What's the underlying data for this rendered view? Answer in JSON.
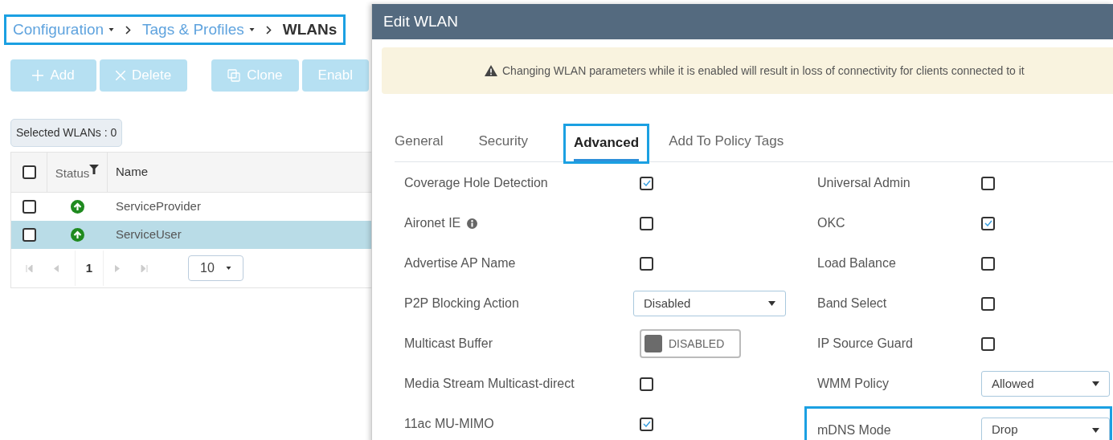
{
  "breadcrumb": {
    "highlighted": true,
    "items": [
      {
        "label": "Configuration",
        "dropdown": true,
        "current": false
      },
      {
        "label": "Tags & Profiles",
        "dropdown": true,
        "current": false
      },
      {
        "label": "WLANs",
        "dropdown": false,
        "current": true
      }
    ]
  },
  "toolbar": [
    {
      "label": "Add"
    },
    {
      "label": "Delete"
    },
    {
      "label": "Clone"
    },
    {
      "label": "Enabl"
    }
  ],
  "selected_count": "Selected WLANs : 0",
  "table": {
    "header_checked": false,
    "columns": [
      "Status",
      "Name"
    ],
    "rows": [
      {
        "checked": false,
        "name": "ServiceProvider",
        "selected": false
      },
      {
        "checked": false,
        "name": "ServiceUser",
        "selected": true
      }
    ]
  },
  "pagination": {
    "page": "1",
    "page_size": "10"
  },
  "modal": {
    "title": "Edit WLAN",
    "warning": "Changing WLAN parameters while it is enabled will result in loss of connectivity for clients connected to it",
    "tabs": [
      {
        "label": "General",
        "selected": false,
        "highlighted": false
      },
      {
        "label": "Security",
        "selected": false,
        "highlighted": false
      },
      {
        "label": "Advanced",
        "selected": true,
        "highlighted": true
      },
      {
        "label": "Add To Policy Tags",
        "selected": false,
        "highlighted": false
      }
    ],
    "left_fields": [
      {
        "kind": "checkbox",
        "label": "Coverage Hole Detection",
        "checked": true
      },
      {
        "kind": "checkbox",
        "label": "Aironet IE",
        "checked": false,
        "info": true
      },
      {
        "kind": "checkbox",
        "label": "Advertise AP Name",
        "checked": false
      },
      {
        "kind": "select",
        "label": "P2P Blocking Action",
        "value": "Disabled"
      },
      {
        "kind": "toggle",
        "label": "Multicast Buffer",
        "value": "DISABLED",
        "on": false
      },
      {
        "kind": "checkbox",
        "label": "Media Stream Multicast-direct",
        "checked": false
      },
      {
        "kind": "checkbox",
        "label": "11ac MU-MIMO",
        "checked": true
      }
    ],
    "right_fields": [
      {
        "kind": "checkbox",
        "label": "Universal Admin",
        "checked": false
      },
      {
        "kind": "checkbox",
        "label": "OKC",
        "checked": true
      },
      {
        "kind": "checkbox",
        "label": "Load Balance",
        "checked": false
      },
      {
        "kind": "checkbox",
        "label": "Band Select",
        "checked": false
      },
      {
        "kind": "checkbox",
        "label": "IP Source Guard",
        "checked": false
      },
      {
        "kind": "select",
        "label": "WMM Policy",
        "value": "Allowed"
      },
      {
        "kind": "select",
        "label": "mDNS Mode",
        "value": "Drop",
        "highlighted": true
      }
    ]
  }
}
